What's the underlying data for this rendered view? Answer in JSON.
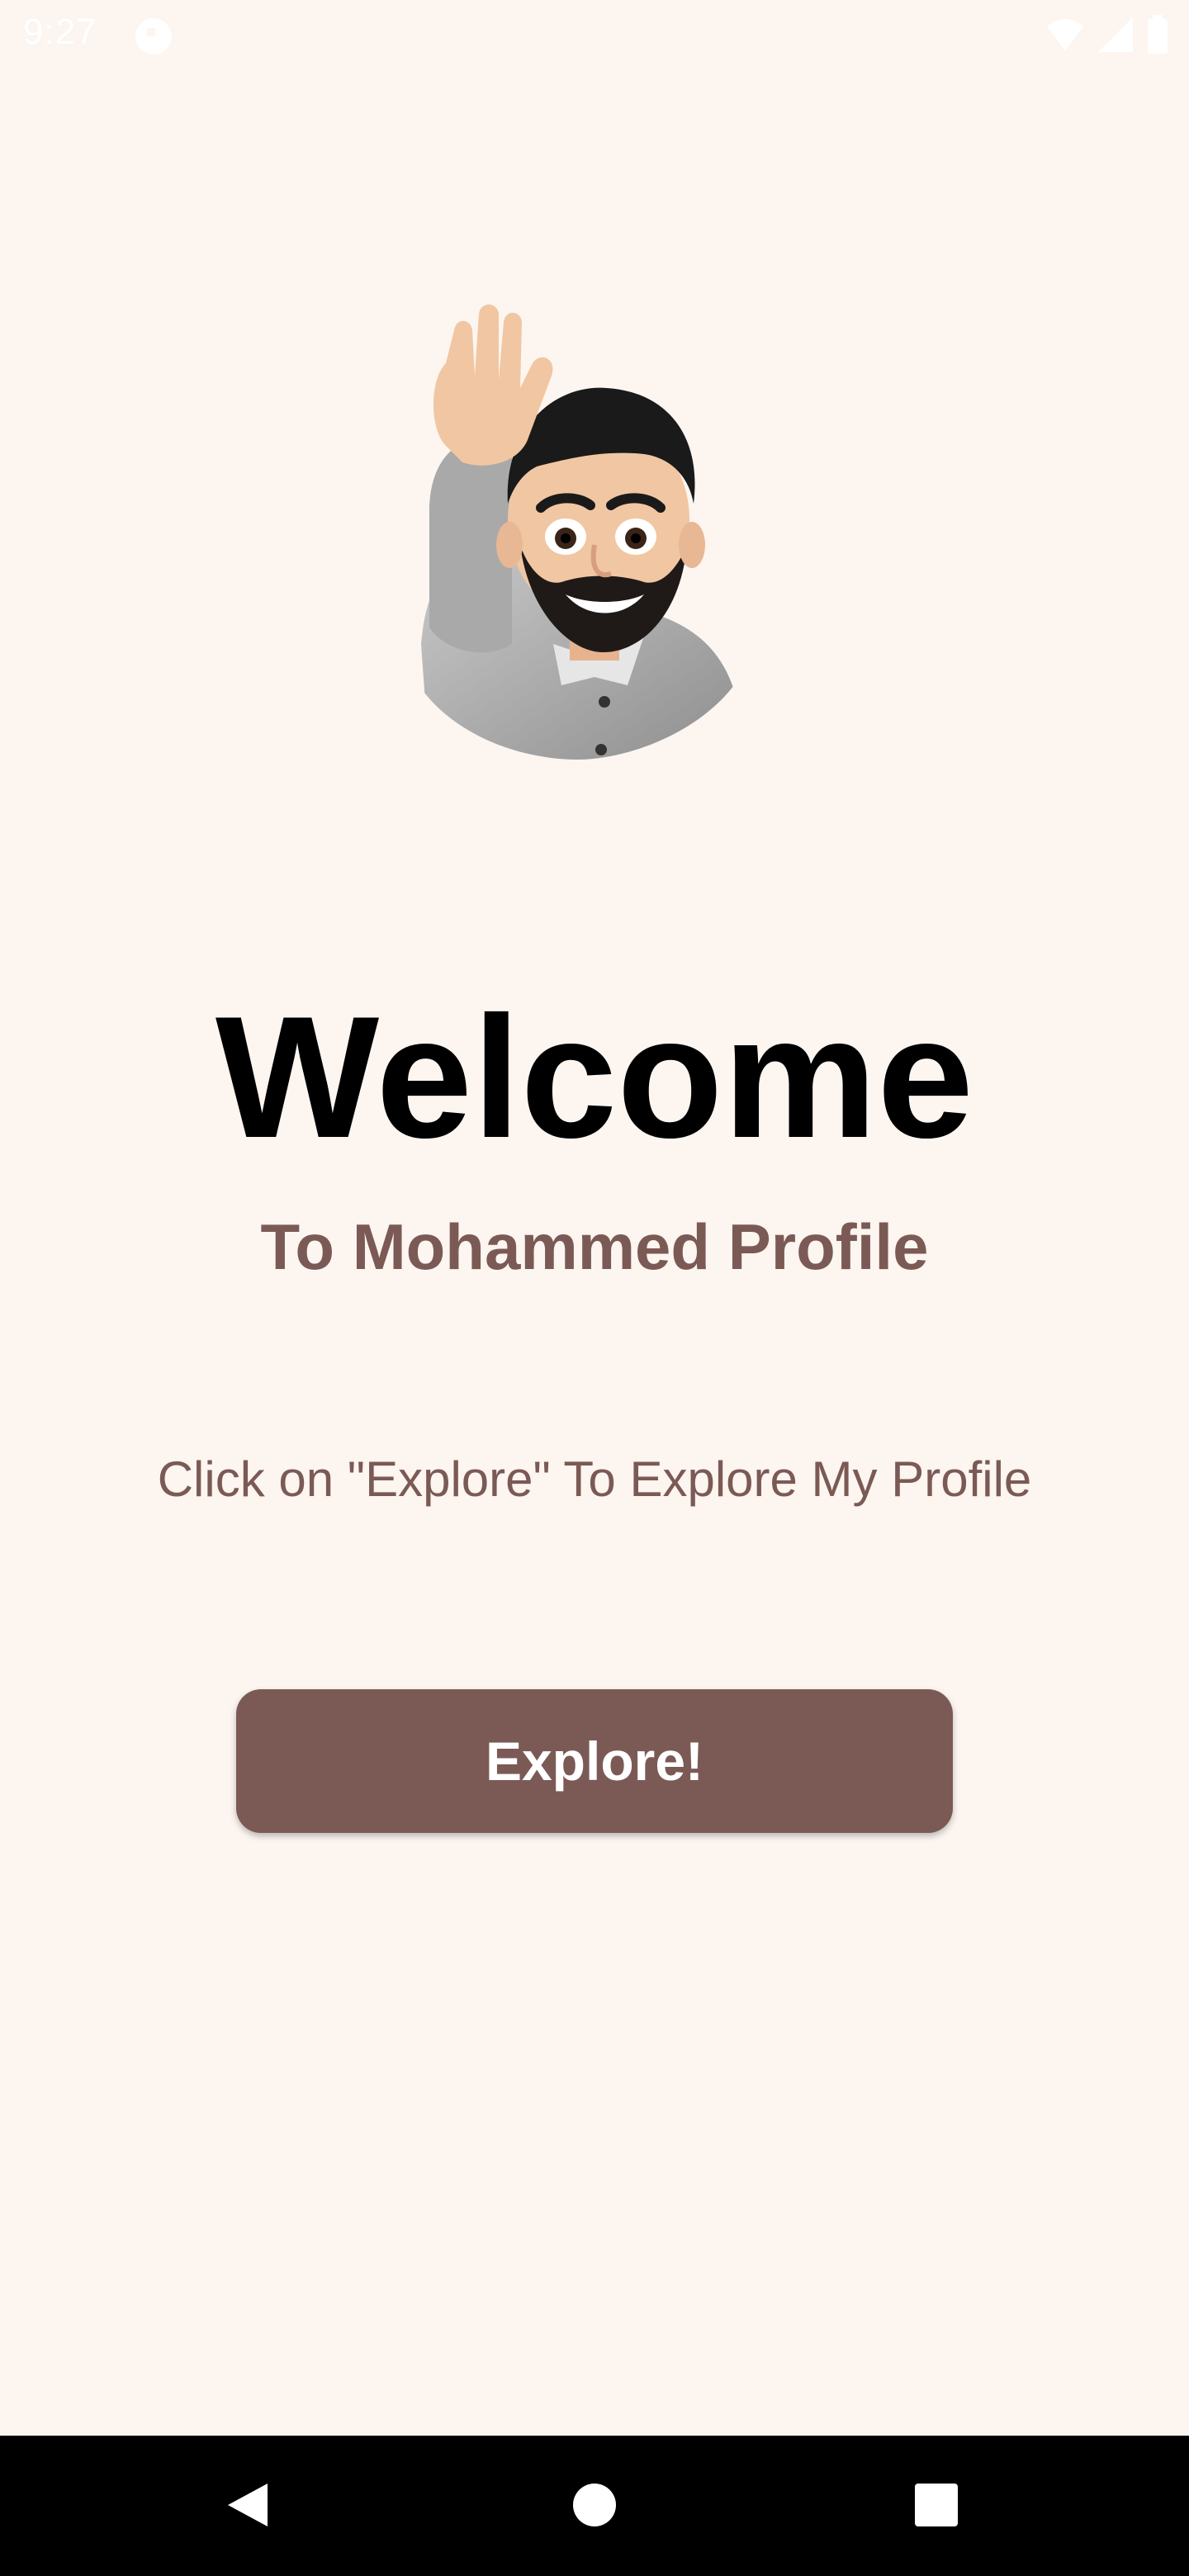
{
  "status_bar": {
    "time": "9:27",
    "icons": [
      "notification-icon",
      "wifi-icon",
      "signal-icon",
      "battery-icon"
    ]
  },
  "avatar": {
    "icon": "waving-memoji-avatar"
  },
  "welcome": {
    "title": "Welcome",
    "subtitle": "To Mohammed Profile",
    "instruction": "Click on \"Explore\" To Explore My Profile"
  },
  "explore_button": {
    "label": "Explore!"
  },
  "nav_bar": {
    "icons": [
      "back-icon",
      "home-icon",
      "recents-icon"
    ]
  },
  "colors": {
    "background": "#fcf5f0",
    "accent": "#7b5a55",
    "title": "#000000",
    "button_text": "#ffffff",
    "nav_bar": "#000000"
  }
}
